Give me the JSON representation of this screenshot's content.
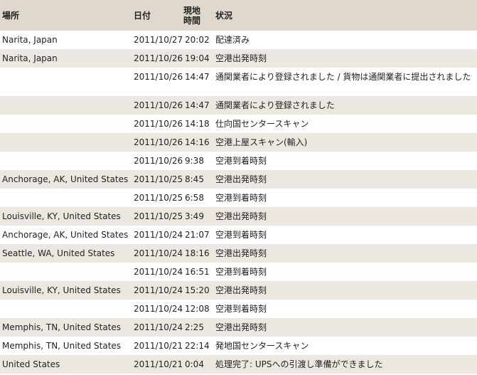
{
  "headers": {
    "location": "場所",
    "date": "日付",
    "local_time_line1": "現地",
    "local_time_line2": "時間",
    "status": "状況"
  },
  "rows": [
    {
      "location": "Narita, Japan",
      "date": "2011/10/27",
      "time": "20:02",
      "status": "配達済み"
    },
    {
      "location": "Narita, Japan",
      "date": "2011/10/26",
      "time": "19:04",
      "status": "空港出発時刻"
    },
    {
      "location": "",
      "date": "2011/10/26",
      "time": "14:47",
      "status": "通関業者により登録されました / 貨物は通関業者に提出されました"
    },
    {
      "location": "",
      "date": "2011/10/26",
      "time": "14:47",
      "status": "通関業者により登録されました"
    },
    {
      "location": "",
      "date": "2011/10/26",
      "time": "14:18",
      "status": "仕向国センタースキャン"
    },
    {
      "location": "",
      "date": "2011/10/26",
      "time": "14:16",
      "status": "空港上屋スキャン(輸入)"
    },
    {
      "location": "",
      "date": "2011/10/26",
      "time": "9:38",
      "status": "空港到着時刻"
    },
    {
      "location": "Anchorage, AK, United States",
      "date": "2011/10/25",
      "time": "8:45",
      "status": "空港出発時刻"
    },
    {
      "location": "",
      "date": "2011/10/25",
      "time": "6:58",
      "status": "空港到着時刻"
    },
    {
      "location": "Louisville, KY, United States",
      "date": "2011/10/25",
      "time": "3:49",
      "status": "空港出発時刻"
    },
    {
      "location": "Anchorage, AK, United States",
      "date": "2011/10/24",
      "time": "21:07",
      "status": "空港到着時刻"
    },
    {
      "location": "Seattle, WA, United States",
      "date": "2011/10/24",
      "time": "18:16",
      "status": "空港出発時刻"
    },
    {
      "location": "",
      "date": "2011/10/24",
      "time": "16:51",
      "status": "空港到着時刻"
    },
    {
      "location": "Louisville, KY, United States",
      "date": "2011/10/24",
      "time": "15:20",
      "status": "空港出発時刻"
    },
    {
      "location": "",
      "date": "2011/10/24",
      "time": "12:08",
      "status": "空港到着時刻"
    },
    {
      "location": "Memphis, TN, United States",
      "date": "2011/10/24",
      "time": "2:25",
      "status": "空港出発時刻"
    },
    {
      "location": "Memphis, TN, United States",
      "date": "2011/10/21",
      "time": "22:14",
      "status": "発地国センタースキャン"
    },
    {
      "location": "United States",
      "date": "2011/10/21",
      "time": "0:04",
      "status": "処理完了: UPSへの引渡し準備ができました"
    }
  ]
}
